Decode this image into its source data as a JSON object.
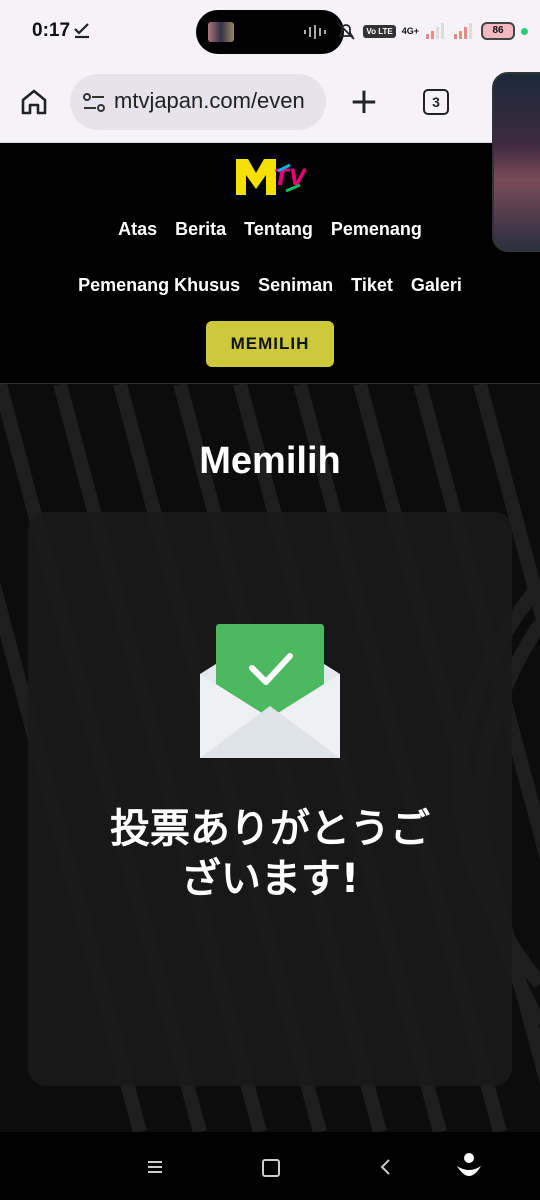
{
  "status_bar": {
    "time": "0:17",
    "network": "4G+",
    "volte": "Vo LTE",
    "battery": "86"
  },
  "browser": {
    "url": "mtvjapan.com/even",
    "tab_count": "3"
  },
  "site_nav": {
    "row1": [
      "Atas",
      "Berita",
      "Tentang",
      "Pemenang"
    ],
    "row2": [
      "Pemenang Khusus",
      "Seniman",
      "Tiket",
      "Galeri"
    ],
    "vote_button": "MEMILIH"
  },
  "main": {
    "title": "Memilih",
    "thanks_line1": "投票ありがとうご",
    "thanks_line2": "ざいます!"
  },
  "colors": {
    "accent": "#ccc93b",
    "check_green": "#4cb860"
  }
}
